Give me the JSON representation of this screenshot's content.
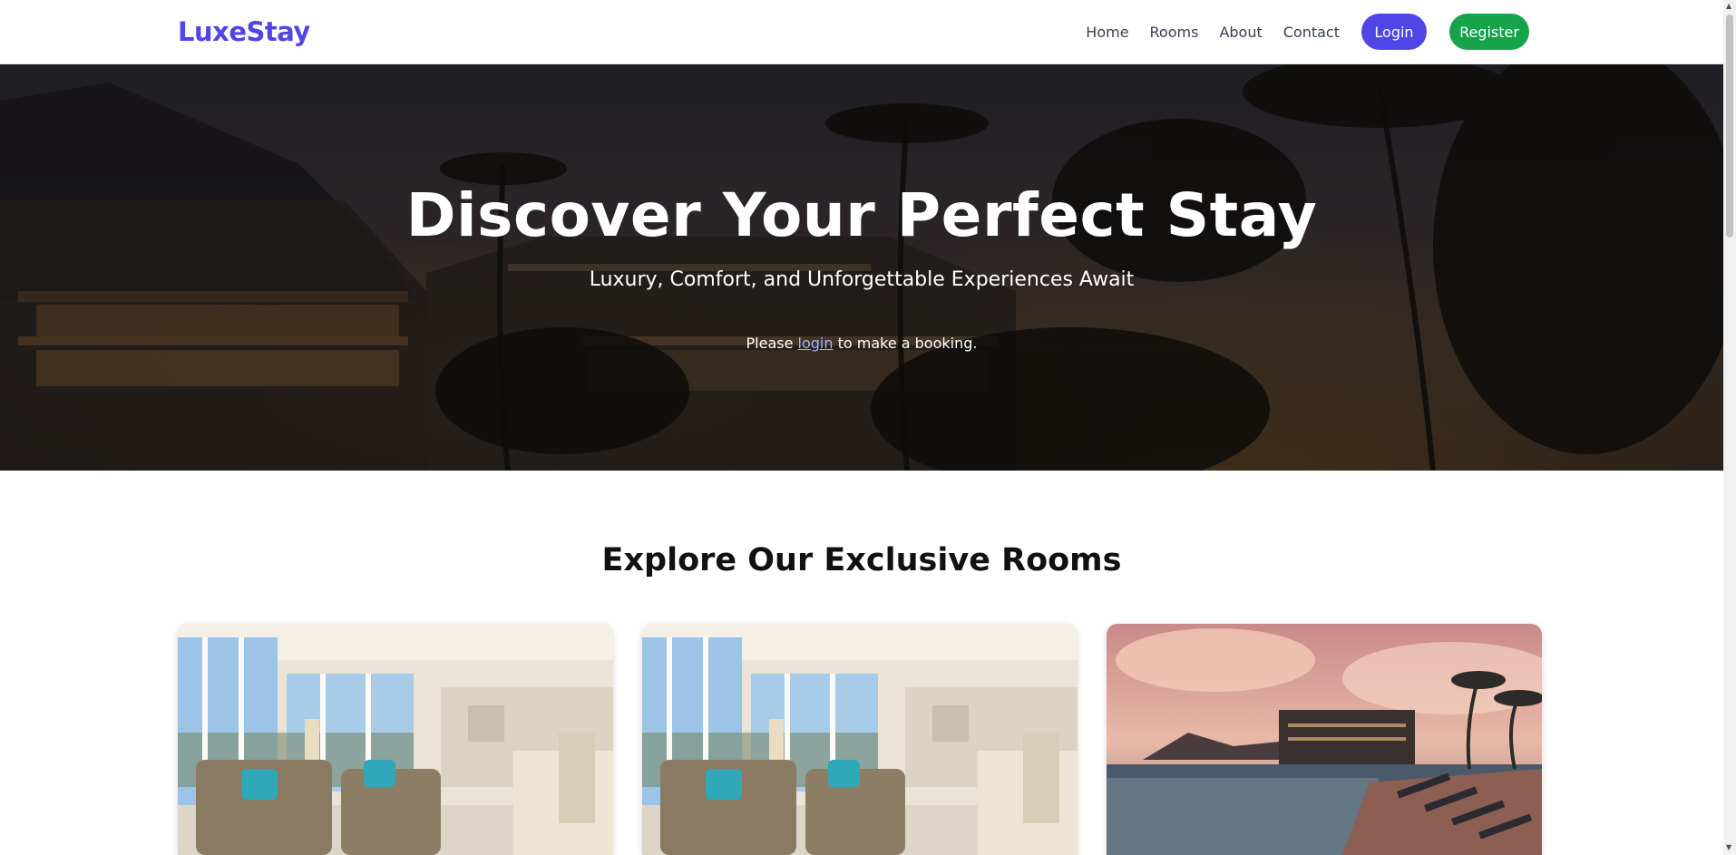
{
  "brand": "LuxeStay",
  "nav": {
    "home": "Home",
    "rooms": "Rooms",
    "about": "About",
    "contact": "Contact",
    "login": "Login",
    "register": "Register"
  },
  "hero": {
    "title": "Discover Your Perfect Stay",
    "subtitle": "Luxury, Comfort, and Unforgettable Experiences Await",
    "note_prefix": "Please",
    "note_link": "login",
    "note_suffix": "to make a booking."
  },
  "rooms_section": {
    "title": "Explore Our Exclusive Rooms"
  },
  "colors": {
    "brand": "#4f46e5",
    "login_button": "#4f46e5",
    "register_button": "#16a34a"
  }
}
